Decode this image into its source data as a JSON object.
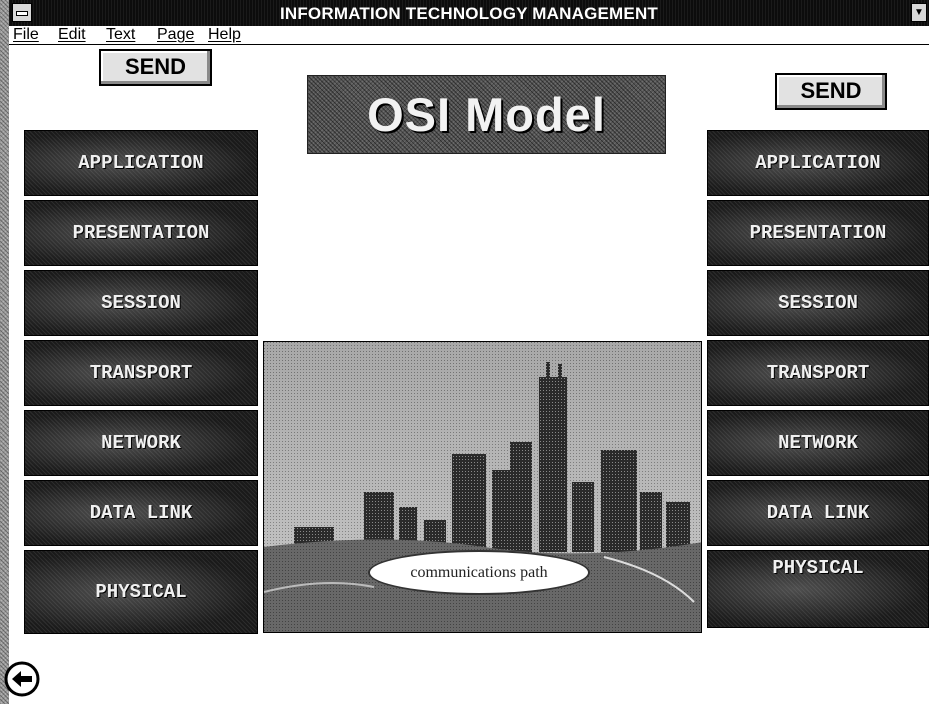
{
  "window": {
    "title": "INFORMATION TECHNOLOGY MANAGEMENT"
  },
  "menu": [
    "File",
    "Edit",
    "Text",
    "Page",
    "Help"
  ],
  "send_left": "SEND",
  "send_right": "SEND",
  "banner": "OSI Model",
  "layers_left": [
    "APPLICATION",
    "PRESENTATION",
    "SESSION",
    "TRANSPORT",
    "NETWORK",
    "DATA LINK",
    "PHYSICAL"
  ],
  "layers_right": [
    "APPLICATION",
    "PRESENTATION",
    "SESSION",
    "TRANSPORT",
    "NETWORK",
    "DATA LINK",
    "PHYSICAL"
  ],
  "image_caption": "communications path",
  "icons": {
    "system_menu": "system-menu-icon",
    "scroll": "scroll-arrow-icon",
    "back": "back-arrow-icon"
  },
  "colors": {
    "title_bar": "#0c0c0c",
    "layer_bg": "#1a1a1a",
    "button_bg": "#e2e2e2",
    "banner_bg": "#555555"
  }
}
